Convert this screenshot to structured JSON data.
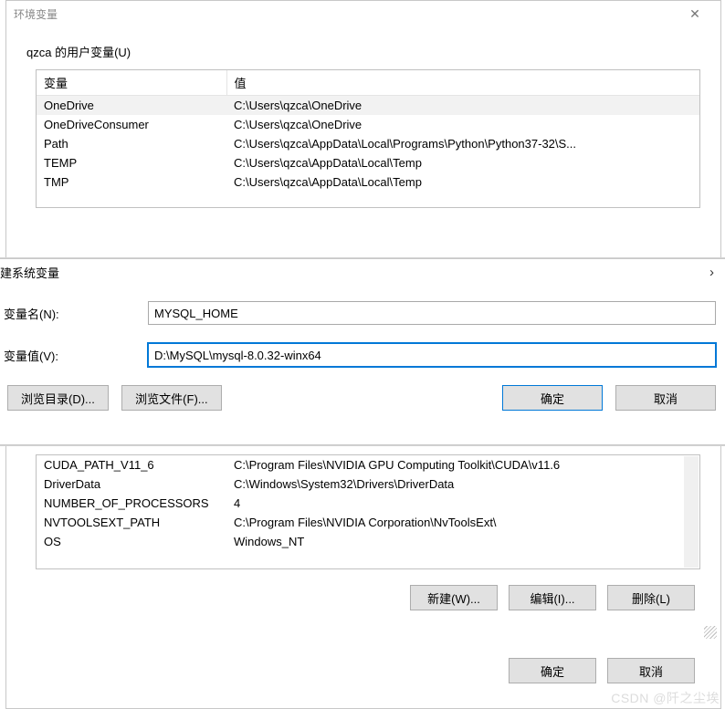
{
  "env_window": {
    "title": "环境变量",
    "close_glyph": "✕",
    "user_vars_label": "qzca 的用户变量(U)",
    "col_name": "变量",
    "col_value": "值",
    "user_rows": [
      {
        "name": "OneDrive",
        "value": "C:\\Users\\qzca\\OneDrive",
        "selected": true
      },
      {
        "name": "OneDriveConsumer",
        "value": "C:\\Users\\qzca\\OneDrive"
      },
      {
        "name": "Path",
        "value": "C:\\Users\\qzca\\AppData\\Local\\Programs\\Python\\Python37-32\\S..."
      },
      {
        "name": "TEMP",
        "value": "C:\\Users\\qzca\\AppData\\Local\\Temp"
      },
      {
        "name": "TMP",
        "value": "C:\\Users\\qzca\\AppData\\Local\\Temp"
      }
    ],
    "system_rows": [
      {
        "name": "CUDA_PATH_V11_6",
        "value": "C:\\Program Files\\NVIDIA GPU Computing Toolkit\\CUDA\\v11.6"
      },
      {
        "name": "DriverData",
        "value": "C:\\Windows\\System32\\Drivers\\DriverData"
      },
      {
        "name": "NUMBER_OF_PROCESSORS",
        "value": "4"
      },
      {
        "name": "NVTOOLSEXT_PATH",
        "value": "C:\\Program Files\\NVIDIA Corporation\\NvToolsExt\\"
      },
      {
        "name": "OS",
        "value": "Windows_NT"
      }
    ],
    "btn_new": "新建(W)...",
    "btn_edit": "编辑(I)...",
    "btn_delete": "删除(L)",
    "btn_ok": "确定",
    "btn_cancel": "取消"
  },
  "new_sysvar_dialog": {
    "title": "建系统变量",
    "chevron": "›",
    "label_name": "变量名(N):",
    "value_name": "MYSQL_HOME",
    "label_value": "变量值(V):",
    "value_value": "D:\\MySQL\\mysql-8.0.32-winx64",
    "btn_browse_dir": "浏览目录(D)...",
    "btn_browse_file": "浏览文件(F)...",
    "btn_ok": "确定",
    "btn_cancel": "取消"
  },
  "watermark": "CSDN @阡之尘埃"
}
